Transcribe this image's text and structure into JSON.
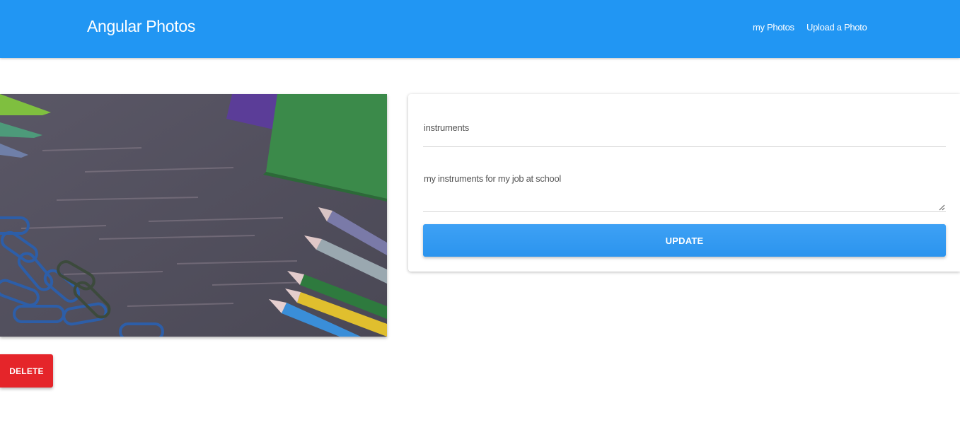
{
  "navbar": {
    "brand": "Angular Photos",
    "links": [
      {
        "label": "my Photos"
      },
      {
        "label": "Upload a Photo"
      }
    ]
  },
  "photo": {
    "subject": "pencils, paper clips and notebooks on a wooden desk"
  },
  "actions": {
    "delete_label": "DELETE"
  },
  "form": {
    "title_value": "instruments",
    "description_value": "my instruments for my job at school",
    "update_label": "UPDATE"
  },
  "colors": {
    "primary": "#2196f3",
    "danger": "#e5252a"
  }
}
